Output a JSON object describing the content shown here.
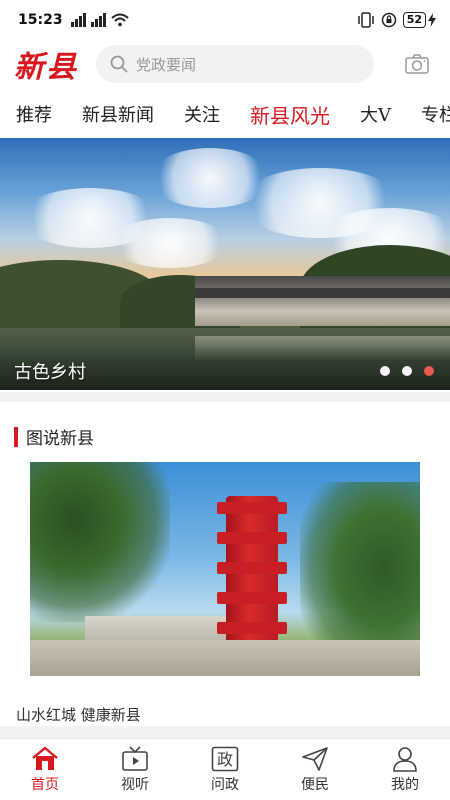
{
  "status_bar": {
    "time": "15:23",
    "battery": "52"
  },
  "header": {
    "logo_text": "新县",
    "search_placeholder": "党政要闻"
  },
  "tabs": [
    {
      "label": "推荐",
      "active": false
    },
    {
      "label": "新县新闻",
      "active": false
    },
    {
      "label": "关注",
      "active": false
    },
    {
      "label": "新县风光",
      "active": true
    },
    {
      "label": "大V",
      "active": false
    },
    {
      "label": "专栏",
      "active": false
    }
  ],
  "banner": {
    "caption": "古色乡村",
    "slide_count": 3,
    "active_slide": 3
  },
  "section": {
    "title": "图说新县",
    "photo_caption": "山水红城 健康新县"
  },
  "bottom_nav": [
    {
      "label": "首页",
      "icon": "home-icon",
      "active": true
    },
    {
      "label": "视听",
      "icon": "tv-icon",
      "active": false
    },
    {
      "label": "问政",
      "icon": "zheng-icon",
      "icon_text": "政",
      "active": false
    },
    {
      "label": "便民",
      "icon": "send-icon",
      "active": false
    },
    {
      "label": "我的",
      "icon": "user-icon",
      "active": false
    }
  ],
  "colors": {
    "accent": "#d7191f",
    "dot_active": "#e65a4f"
  }
}
